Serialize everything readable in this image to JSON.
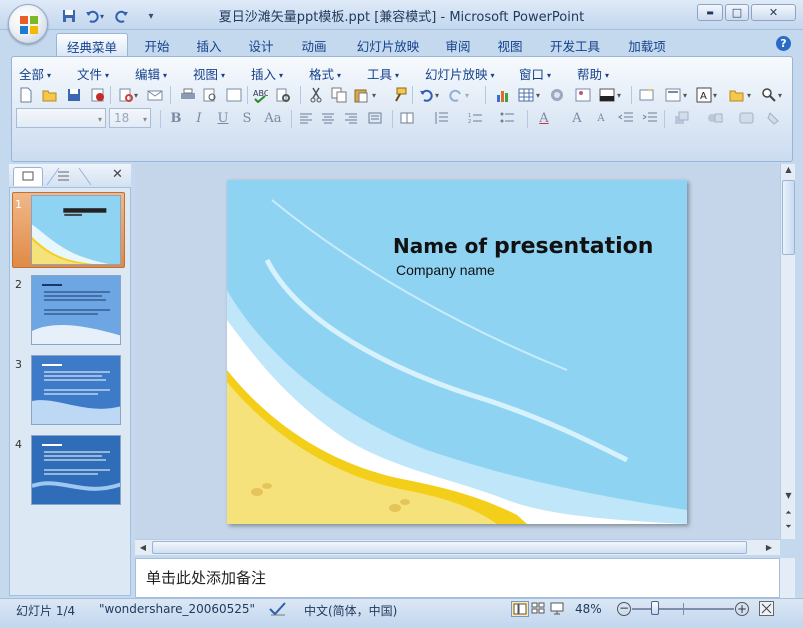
{
  "window": {
    "title": "夏日沙滩矢量ppt模板.ppt [兼容模式] - Microsoft PowerPoint",
    "minimize_label": "▬",
    "maximize_label": "□",
    "close_label": "✕"
  },
  "quick_access": {
    "icons": [
      "save-icon",
      "undo-icon",
      "redo-icon",
      "customize-icon"
    ],
    "more": "▾"
  },
  "tabs": [
    {
      "label": "经典菜单",
      "active": true
    },
    {
      "label": "开始",
      "active": false
    },
    {
      "label": "插入",
      "active": false
    },
    {
      "label": "设计",
      "active": false
    },
    {
      "label": "动画",
      "active": false
    },
    {
      "label": "幻灯片放映",
      "active": false
    },
    {
      "label": "审阅",
      "active": false
    },
    {
      "label": "视图",
      "active": false
    },
    {
      "label": "开发工具",
      "active": false
    },
    {
      "label": "加载项",
      "active": false
    }
  ],
  "menu": [
    "全部",
    "文件",
    "编辑",
    "视图",
    "插入",
    "格式",
    "工具",
    "幻灯片放映",
    "窗口",
    "帮助"
  ],
  "format_bar": {
    "font_name": "",
    "font_size": "18",
    "bold": "B",
    "italic": "I",
    "underline": "U",
    "shadow": "S",
    "case": "Aa",
    "font_color": "A",
    "grow": "A",
    "shrink": "A"
  },
  "panes": {
    "close_label": "✕"
  },
  "thumbnails": [
    {
      "num": "1",
      "selected": true
    },
    {
      "num": "2",
      "selected": false
    },
    {
      "num": "3",
      "selected": false
    },
    {
      "num": "4",
      "selected": false
    }
  ],
  "slide": {
    "title_prefix": "Name of ",
    "title_bold": "presentation",
    "subtitle": "Company name"
  },
  "notes": {
    "placeholder": "单击此处添加备注"
  },
  "status": {
    "slide_info": "幻灯片 1/4",
    "theme": "\"wondershare_20060525\"",
    "language": "中文(简体，中国)",
    "zoom": "48%"
  },
  "colors": {
    "ribbon_bg": "#dde8f5",
    "slide_sky": "#8fd3f3",
    "sand": "#f6e27a",
    "sand_edge": "#f3cf19",
    "selection": "#e08a46"
  }
}
